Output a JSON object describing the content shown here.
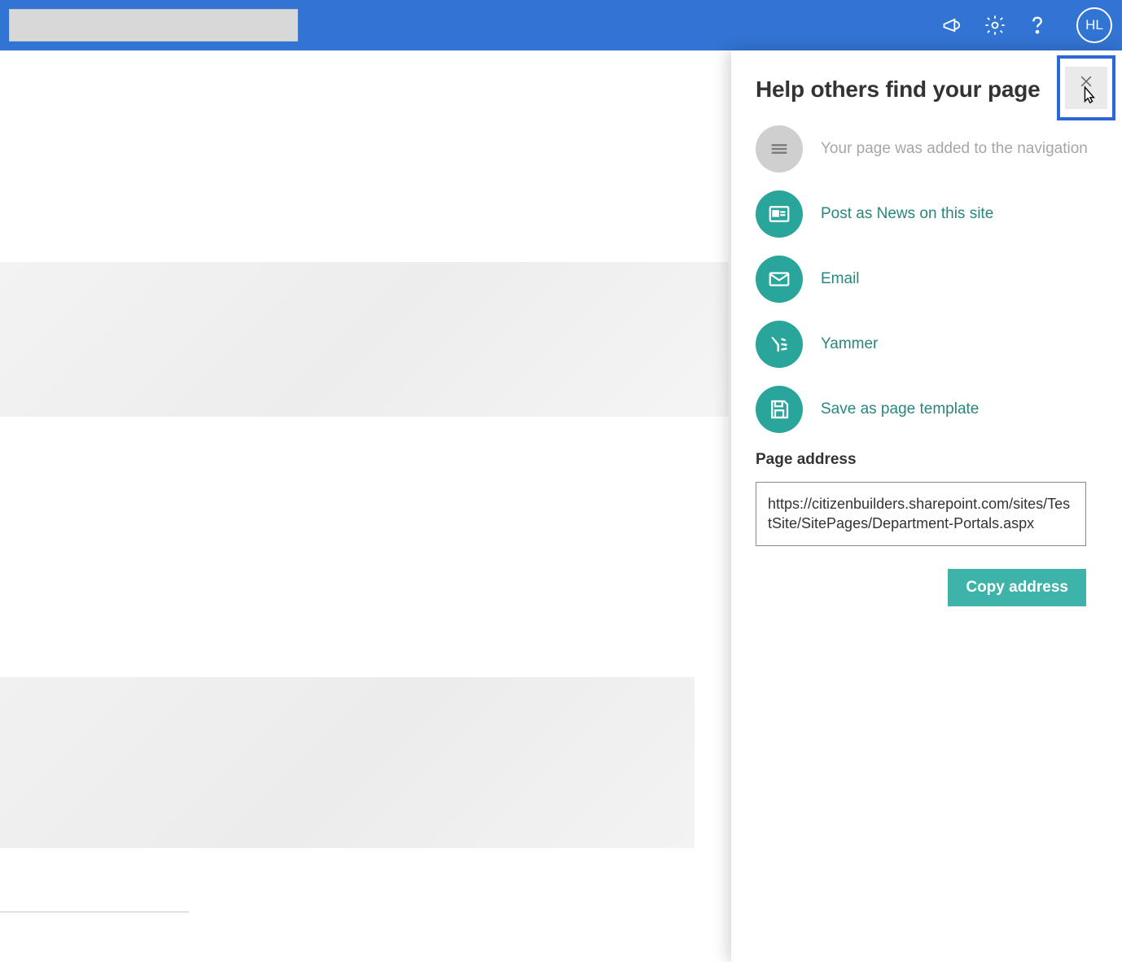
{
  "header": {
    "avatar_initials": "HL"
  },
  "panel": {
    "title": "Help others find your page",
    "items": {
      "nav_added": "Your page was added to the navigation",
      "post_news": "Post as News on this site",
      "email": "Email",
      "yammer": "Yammer",
      "save_template": "Save as page template"
    },
    "address_label": "Page address",
    "address_value": "https://citizenbuilders.sharepoint.com/sites/TestSite/SitePages/Department-Portals.aspx",
    "copy_label": "Copy address"
  }
}
